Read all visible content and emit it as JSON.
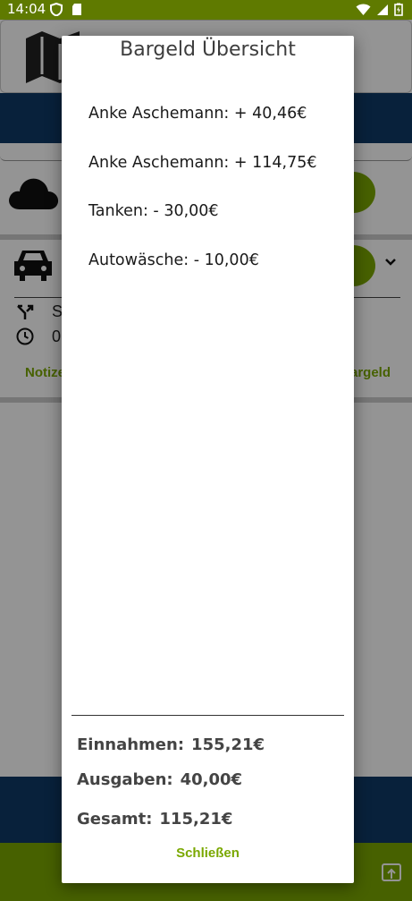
{
  "status_bar": {
    "time": "14:04"
  },
  "background": {
    "route_text": "S",
    "time_text": "0",
    "notes_link": "Notize",
    "cash_link": "argeld"
  },
  "dialog": {
    "title": "Bargeld Übersicht",
    "entries": [
      "Anke Aschemann: + 40,46€",
      "Anke Aschemann: + 114,75€",
      "Tanken: - 30,00€",
      "Autowäsche: - 10,00€"
    ],
    "income_label": "Einnahmen:",
    "income_value": "155,21€",
    "expense_label": "Ausgaben:",
    "expense_value": "40,00€",
    "total_label": "Gesamt:",
    "total_value": "115,21€",
    "close_label": "Schließen"
  },
  "colors": {
    "accent_green": "#7aa800",
    "navy": "#0f3a66",
    "status_bar_green": "#5f7a00"
  }
}
